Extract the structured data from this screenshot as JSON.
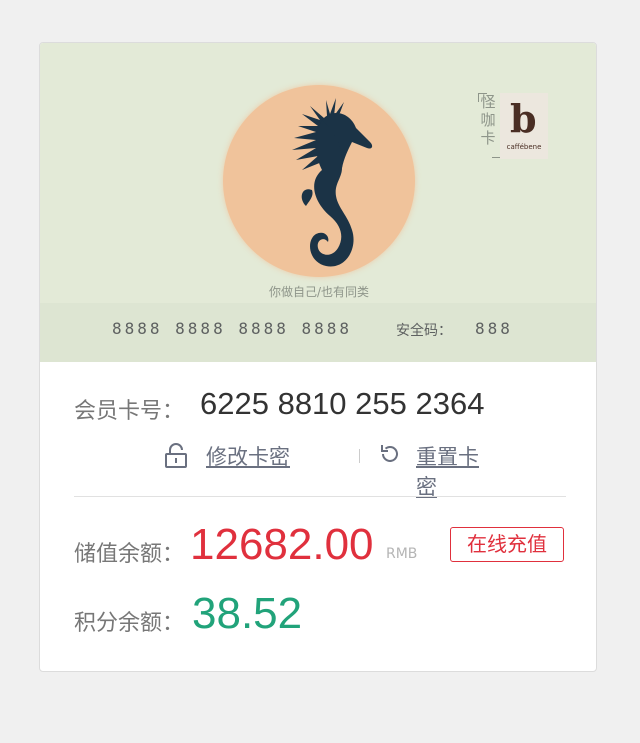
{
  "card": {
    "brand_name": "怪咖卡",
    "logo_letter": "b",
    "logo_caption": "caffébene",
    "slogan": "你做自己/也有同类",
    "card_number": "8888  8888 8888 8888",
    "security_label": "安全码：",
    "security_code": "888"
  },
  "member": {
    "label": "会员卡号：",
    "number": "6225 8810 255 2364"
  },
  "actions": {
    "change_pin": "修改卡密",
    "reset_pin": "重置卡密"
  },
  "balance": {
    "label": "储值余额：",
    "value": "12682.00",
    "unit": "RMB",
    "recharge_label": "在线充值"
  },
  "points": {
    "label": "积分余额：",
    "value": "38.52"
  },
  "colors": {
    "balance": "#e0303d",
    "points": "#21a37a",
    "card_bg": "#e3ead7",
    "circle": "#f0c39b",
    "seahorse": "#1b3346"
  }
}
